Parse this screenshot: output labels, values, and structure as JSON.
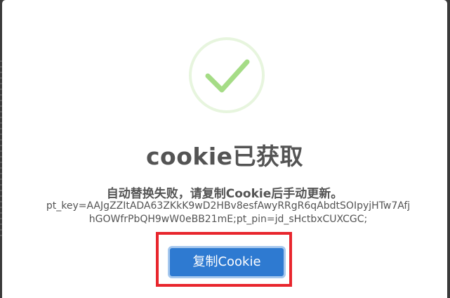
{
  "dialog": {
    "title": "cookie已获取",
    "subtitle": "自动替换失败，请复制Cookie后手动更新。",
    "cookie_value": "pt_key=AAJgZZItADA63ZKkK9wD2HBv8esfAwyRRgR6qAbdtSOIpyjHTw7AfjhGOWfrPbQH9wW0eBB21mE;pt_pin=jd_sHctbxCUXCGC;",
    "copy_button_label": "复制Cookie",
    "icon": "success-checkmark-icon"
  },
  "colors": {
    "title_text": "#545454",
    "check_green": "#a5dc86",
    "check_ring": "#e7f5de",
    "button_bg": "#2e7ad1",
    "button_border": "#a6c8ee",
    "highlight_border": "#e8262d",
    "backdrop": "#3a3a3a"
  }
}
